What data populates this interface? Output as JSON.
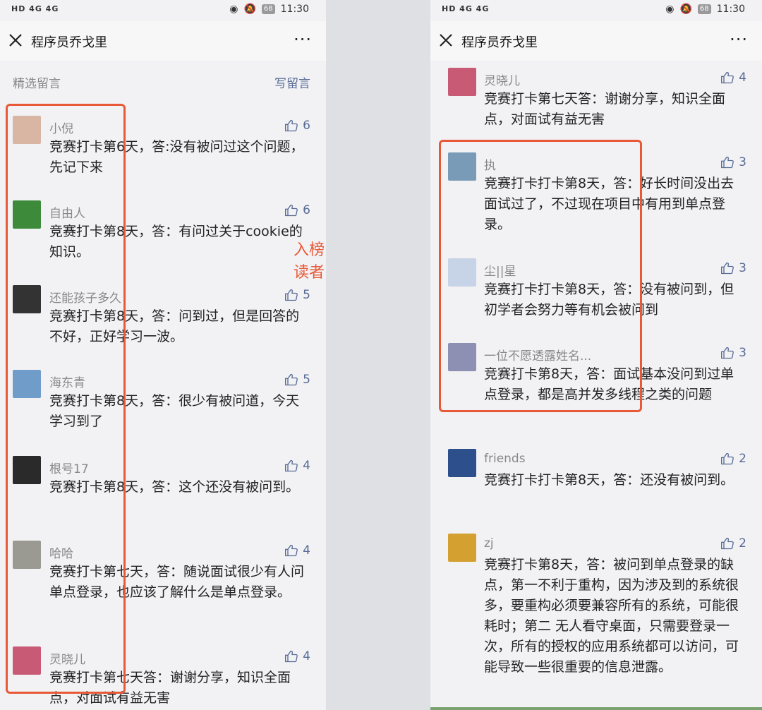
{
  "status": {
    "network": "HD 4G 4G",
    "battery": "68",
    "time": "11:30"
  },
  "left": {
    "title": "程序员乔戈里",
    "section_title": "精选留言",
    "write_label": "写留言",
    "annotation": "入榜读者",
    "comments": [
      {
        "name": "小倪",
        "likes": "6",
        "text": "竞赛打卡第6天，答:没有被问过这个问题，先记下来",
        "avatar_color": "#d9b6a4"
      },
      {
        "name": "自由人",
        "likes": "6",
        "text": "竞赛打卡第8天，答：有问过关于cookie的知识。",
        "avatar_color": "#3c8a3a"
      },
      {
        "name": "还能孩子多久",
        "likes": "5",
        "text": "竞赛打卡第8天，答：问到过，但是回答的不好，正好学习一波。",
        "avatar_color": "#333333"
      },
      {
        "name": "海东青",
        "likes": "5",
        "text": "竞赛打卡第8天，答：很少有被问道，今天学习到了",
        "avatar_color": "#6f9cc9"
      },
      {
        "name": "根号17",
        "likes": "4",
        "text": "竞赛打卡第8天，答：这个还没有被问到。",
        "avatar_color": "#2a2a2a"
      },
      {
        "name": "哈哈",
        "likes": "4",
        "text": "竞赛打卡第七天，答：随说面试很少有人问单点登录，也应该了解什么是单点登录。",
        "avatar_color": "#9a9a92"
      },
      {
        "name": "灵晓儿",
        "likes": "4",
        "text": "竞赛打卡第七天答：谢谢分享，知识全面点，对面试有益无害",
        "avatar_color": "#c95a76"
      }
    ]
  },
  "right": {
    "title": "程序员乔戈里",
    "comments": [
      {
        "name": "灵晓儿",
        "likes": "4",
        "text": "竞赛打卡第七天答：谢谢分享，知识全面点，对面试有益无害",
        "avatar_color": "#c95a76"
      },
      {
        "name": "执",
        "likes": "3",
        "text": "竞赛打卡打卡第8天，答：好长时间没出去面试过了，不过现在项目中有用到单点登录。",
        "avatar_color": "#7a9bb8"
      },
      {
        "name": "尘||星",
        "likes": "3",
        "text": "竞赛打卡打卡第8天，答：没有被问到，但初学者会努力等有机会被问到",
        "avatar_color": "#c7d3e6"
      },
      {
        "name": "一位不愿透露姓名...",
        "likes": "3",
        "text": "竞赛打卡第8天，答：面试基本没问到过单点登录，都是高并发多线程之类的问题",
        "avatar_color": "#8d8fb3"
      },
      {
        "name": "friends",
        "likes": "2",
        "text": "竞赛打卡打卡第8天，答：还没有被问到。",
        "avatar_color": "#2d4f8c"
      },
      {
        "name": "zj",
        "likes": "2",
        "text": "竞赛打卡第8天，答：被问到单点登录的缺点，第一不利于重构，因为涉及到的系统很多，要重构必须要兼容所有的系统，可能很耗时；第二 无人看守桌面，只需要登录一次，所有的授权的应用系统都可以访问，可能导致一些很重要的信息泄露。",
        "avatar_color": "#d4a030"
      }
    ]
  }
}
